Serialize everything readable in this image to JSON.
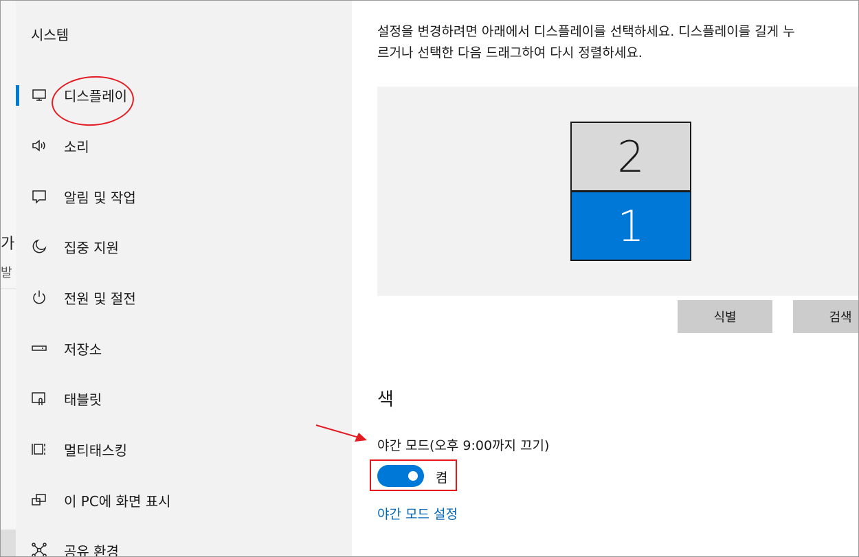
{
  "background_window": {
    "glyph_top": "가",
    "glyph_bottom": "발"
  },
  "sidebar": {
    "title": "시스템",
    "items": [
      {
        "label": "디스플레이",
        "icon": "monitor-icon",
        "selected": true
      },
      {
        "label": "소리",
        "icon": "speaker-icon"
      },
      {
        "label": "알림 및 작업",
        "icon": "notification-icon"
      },
      {
        "label": "집중 지원",
        "icon": "moon-icon"
      },
      {
        "label": "전원 및 절전",
        "icon": "power-icon"
      },
      {
        "label": "저장소",
        "icon": "storage-icon"
      },
      {
        "label": "태블릿",
        "icon": "tablet-icon"
      },
      {
        "label": "멀티태스킹",
        "icon": "multitasking-icon"
      },
      {
        "label": "이 PC에 화면 표시",
        "icon": "project-icon"
      },
      {
        "label": "공유 환경",
        "icon": "share-icon"
      }
    ]
  },
  "main": {
    "description_line1": "설정을 변경하려면 아래에서 디스플레이를 선택하세요. 디스플레이를 길게 누",
    "description_line2": "르거나 선택한 다음 드래그하여 다시 정렬하세요.",
    "monitors": [
      {
        "label": "2",
        "selected": false
      },
      {
        "label": "1",
        "selected": true
      }
    ],
    "identify_button": "식별",
    "detect_button": "검색",
    "color_section": "색",
    "night_mode_label": "야간 모드(오후 9:00까지 끄기)",
    "night_mode_state": "켬",
    "night_mode_link": "야간 모드 설정"
  },
  "colors": {
    "accent": "#0078d7",
    "sidebar_bg": "#f2f2f2",
    "annotation_red": "#e31b22",
    "link": "#0067b8"
  }
}
